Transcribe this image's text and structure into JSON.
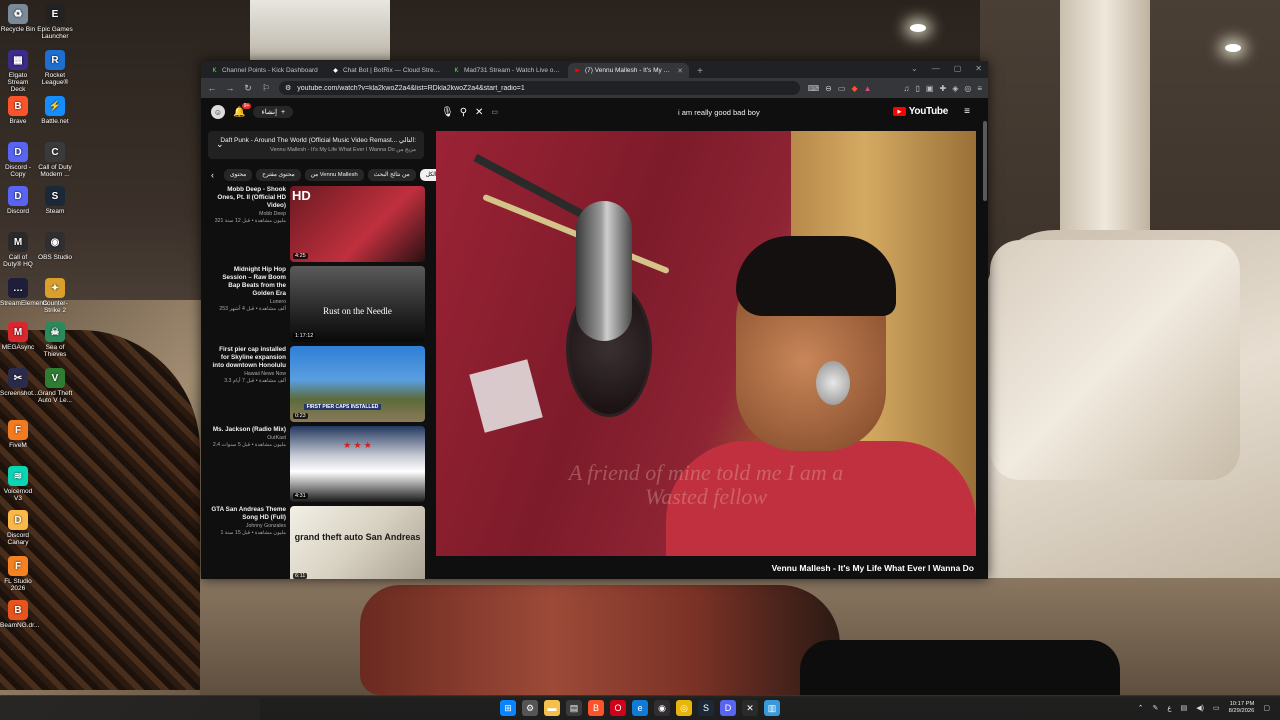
{
  "desktop": {
    "icons": [
      {
        "label": "Recycle Bin",
        "icon": "recycle-bin-icon",
        "color": "#7a8a9a",
        "glyph": "♻"
      },
      {
        "label": "Epic Games Launcher",
        "icon": "epic-games-icon",
        "color": "#222222",
        "glyph": "E"
      },
      {
        "label": "Elgato Stream Deck",
        "icon": "stream-deck-icon",
        "color": "#3b2b8a",
        "glyph": "▦"
      },
      {
        "label": "Rocket League®",
        "icon": "rocket-league-icon",
        "color": "#1f6fd0",
        "glyph": "R"
      },
      {
        "label": "Brave",
        "icon": "brave-icon",
        "color": "#fb542b",
        "glyph": "B"
      },
      {
        "label": "Battle.net",
        "icon": "battlenet-icon",
        "color": "#148eff",
        "glyph": "⚡"
      },
      {
        "label": "Discord - Copy",
        "icon": "discord-icon",
        "color": "#5865f2",
        "glyph": "D"
      },
      {
        "label": "Call of Duty Modern ...",
        "icon": "call-of-duty-icon",
        "color": "#3a3a3a",
        "glyph": "C"
      },
      {
        "label": "Discord",
        "icon": "discord-icon",
        "color": "#5865f2",
        "glyph": "D"
      },
      {
        "label": "Steam",
        "icon": "steam-icon",
        "color": "#1b2838",
        "glyph": "S"
      },
      {
        "label": "Call of Duty® HQ",
        "icon": "call-of-duty-hq-icon",
        "color": "#2a2a2a",
        "glyph": "M"
      },
      {
        "label": "OBS Studio",
        "icon": "obs-icon",
        "color": "#302e31",
        "glyph": "◉"
      },
      {
        "label": "StreamElements",
        "icon": "chat-icon",
        "color": "#1e1e3a",
        "glyph": "…"
      },
      {
        "label": "Counter-Strike 2",
        "icon": "counter-strike-icon",
        "color": "#d9a12b",
        "glyph": "✦"
      },
      {
        "label": "MEGAsync",
        "icon": "mega-icon",
        "color": "#d9272e",
        "glyph": "M"
      },
      {
        "label": "Sea of Thieves",
        "icon": "sea-of-thieves-icon",
        "color": "#2a8a5a",
        "glyph": "☠"
      },
      {
        "label": "Screenshot...",
        "icon": "screenshot-icon",
        "color": "#2a2a4a",
        "glyph": "✂"
      },
      {
        "label": "Grand Theft Auto V Le...",
        "icon": "gta-icon",
        "color": "#2e7d32",
        "glyph": "V"
      },
      {
        "label": "FiveM",
        "icon": "fivem-icon",
        "color": "#f47a20",
        "glyph": "F"
      },
      {
        "label": "Voicemod V3",
        "icon": "voicemod-icon",
        "color": "#0ad6b4",
        "glyph": "≋"
      },
      {
        "label": "Discord Canary",
        "icon": "discord-canary-icon",
        "color": "#fbb848",
        "glyph": "D"
      },
      {
        "label": "FL Studio 2026",
        "icon": "fl-studio-icon",
        "color": "#f58220",
        "glyph": "F"
      },
      {
        "label": "BeamNG.dr...",
        "icon": "beamng-icon",
        "color": "#e8541c",
        "glyph": "B"
      }
    ]
  },
  "browser": {
    "tabs": [
      {
        "label": "Channel Points - Kick Dashboard",
        "fav_color": "#53fc18",
        "fav_glyph": "K",
        "active": false
      },
      {
        "label": "Chat Bot | BotRix — Cloud Streamin...",
        "fav_color": "#ffffff",
        "fav_glyph": "◆",
        "active": false
      },
      {
        "label": "Mad731 Stream - Watch Live on Kick",
        "fav_color": "#53fc18",
        "fav_glyph": "K",
        "active": false
      },
      {
        "label": "(7) Vennu Mallesh - It's My Li...",
        "fav_color": "#ff0000",
        "fav_glyph": "▶",
        "active": true
      }
    ],
    "url": "youtube.com/watch?v=kla2kwoZ2a4&list=RDkla2kwoZ2a4&start_radio=1"
  },
  "youtube": {
    "create_label": "إنشاء",
    "notification_count": "9+",
    "search_query": "i am really good bad boy",
    "logo_text": "YouTube",
    "playlist": {
      "title": "Daft Punk - Around The World (Official Music Video Remast...",
      "title_prefix": "التالي:",
      "subtitle": "Vennu Mallesh - It's My Life What Ever I Wanna Do",
      "subtitle_prefix": "مزيج من"
    },
    "chips": [
      {
        "label": "الكل",
        "active": true
      },
      {
        "label": "من نتائج البحث",
        "active": false
      },
      {
        "label": "من Vennu Mallesh",
        "active": false
      },
      {
        "label": "محتوى مقترح",
        "active": false
      },
      {
        "label": "محتوى",
        "active": false
      }
    ],
    "recommendations": [
      {
        "title": "Mobb Deep - Shook Ones, Pt. II (Official HD Video)",
        "channel": "Mobb Deep",
        "stats": "321 مليون مشاهدة • قبل 12 سنة",
        "duration": "4:25",
        "thumb_text": "HD",
        "thumb_bg": "linear-gradient(135deg,#6b1a22,#c0303e 60%,#2a1012)"
      },
      {
        "title": "Midnight Hip Hop Session – Raw Boom Bap Beats from the Golden Era",
        "channel": "Lunero",
        "stats": "253 ألف مشاهدة • قبل 4 أشهر",
        "duration": "1:17:12",
        "thumb_text": "Rust on the Needle",
        "thumb_bg": "linear-gradient(180deg,#5a5a5a,#1e1e1e 70%,#0a0a0a)"
      },
      {
        "title": "First pier cap installed for Skyline expansion into downtown Honolulu",
        "channel": "Hawaii News Now",
        "stats": "3.3 ألف مشاهدة • قبل 7 أيام",
        "duration": "0:23",
        "thumb_text": "FIRST PIER CAPS INSTALLED",
        "thumb_bg": "linear-gradient(180deg,#2f7fd6,#5a9ee0 45%,#5c6b3a 70%,#8a7a5a)"
      },
      {
        "title": "Ms. Jackson (Radio Mix)",
        "channel": "OutKast",
        "stats": "2.4 مليون مشاهدة • قبل 5 سنوات",
        "duration": "4:31",
        "thumb_text": "★ ★ ★",
        "thumb_bg": "linear-gradient(180deg,#23385f,#c9ccd6 40%,#ffffff 60%,#1a1a1a)"
      },
      {
        "title": "GTA San Andreas Theme Song HD (Full)",
        "channel": "Johnny Gonzales",
        "stats": "1 مليون مشاهدة • قبل 15 سنة",
        "duration": "6:11",
        "thumb_text": "grand theft auto San Andreas",
        "thumb_bg": "linear-gradient(135deg,#f2efe6,#d8d2c2 50%,#a9a090)"
      }
    ],
    "video": {
      "title": "Vennu Mallesh - It's My Life What Ever I Wanna Do",
      "overlay_text": "A friend of mine told me I am a Wasted fellow"
    }
  },
  "taskbar": {
    "apps": [
      {
        "icon": "windows-start-icon",
        "color": "#0a84ff",
        "glyph": "⊞"
      },
      {
        "icon": "settings-icon",
        "color": "#555555",
        "glyph": "⚙"
      },
      {
        "icon": "file-explorer-icon",
        "color": "#f5c04a",
        "glyph": "▬"
      },
      {
        "icon": "calendar-icon",
        "color": "#3a3a3a",
        "glyph": "▤"
      },
      {
        "icon": "brave-icon",
        "color": "#fb542b",
        "glyph": "B"
      },
      {
        "icon": "opera-icon",
        "color": "#d0021b",
        "glyph": "O"
      },
      {
        "icon": "edge-icon",
        "color": "#0f7bd9",
        "glyph": "e"
      },
      {
        "icon": "obs-icon",
        "color": "#302e31",
        "glyph": "◉"
      },
      {
        "icon": "chrome-icon",
        "color": "#e8b60a",
        "glyph": "◎"
      },
      {
        "icon": "steam-icon",
        "color": "#1b2838",
        "glyph": "S"
      },
      {
        "icon": "discord-icon",
        "color": "#5865f2",
        "glyph": "D"
      },
      {
        "icon": "capcut-icon",
        "color": "#2a2a2a",
        "glyph": "✕"
      },
      {
        "icon": "notepad-icon",
        "color": "#3a9ad9",
        "glyph": "▥"
      }
    ],
    "time": "10:17 PM",
    "date": "8/29/2026"
  }
}
